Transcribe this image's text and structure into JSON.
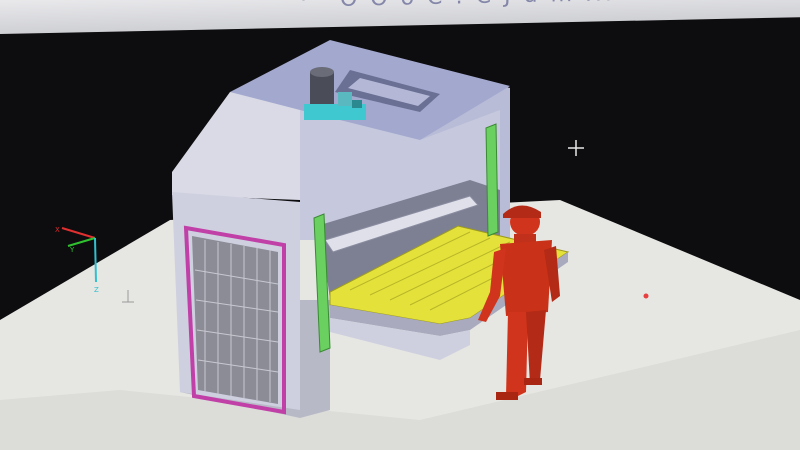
{
  "window": {
    "title_fragment": "· · O O o C : C J u m ..."
  },
  "viewport": {
    "background_color": "#0d0d0f",
    "floor_color": "#e8e8e6"
  },
  "axis_triad": {
    "x_label": "X",
    "y_label": "Y",
    "z_label": "Z",
    "x_color": "#e03030",
    "y_color": "#30c030",
    "z_color": "#30c0d0"
  },
  "model": {
    "body_color": "#cfd0e2",
    "roof_color": "#9aa0c8",
    "tray_color": "#e4e23a",
    "door_frame_color": "#c040a8",
    "column_color": "#6ad060",
    "hydraulics_color": "#40c8d0",
    "operator_color": "#d0341c"
  },
  "cursor_icon": "crosshair-icon"
}
